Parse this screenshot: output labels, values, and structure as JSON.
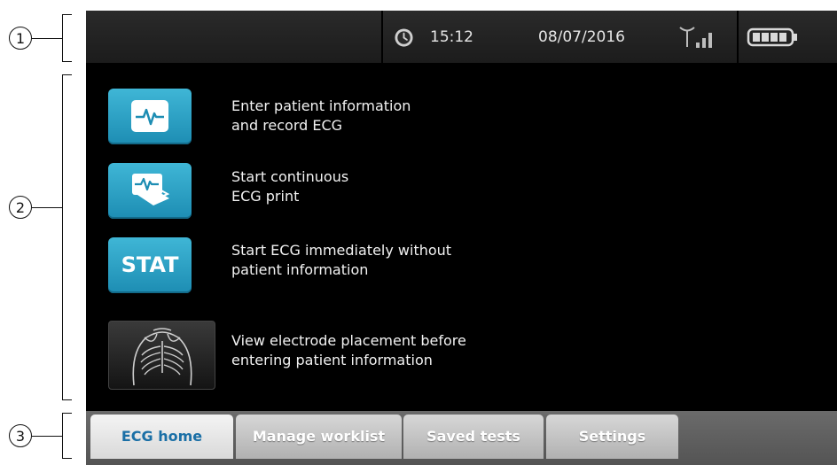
{
  "callouts": [
    "1",
    "2",
    "3"
  ],
  "status": {
    "time": "15:12",
    "date": "08/07/2016",
    "clock_icon": "clock-icon",
    "signal_icon": "antenna-signal-icon",
    "battery_icon": "battery-full-icon"
  },
  "actions": [
    {
      "icon": "ecg-waveform-icon",
      "line1": "Enter patient information",
      "line2": "and record ECG"
    },
    {
      "icon": "ecg-print-icon",
      "line1": "Start continuous",
      "line2": "ECG print"
    },
    {
      "button_label": "STAT",
      "line1": "Start ECG immediately without",
      "line2": "patient information"
    },
    {
      "icon": "chest-electrode-icon",
      "line1": "View electrode placement before",
      "line2": "entering patient information"
    }
  ],
  "tabs": [
    "ECG home",
    "Manage worklist",
    "Saved tests",
    "Settings"
  ],
  "colors": {
    "accent": "#1d8db3",
    "active_tab_text": "#1a6fa6"
  }
}
